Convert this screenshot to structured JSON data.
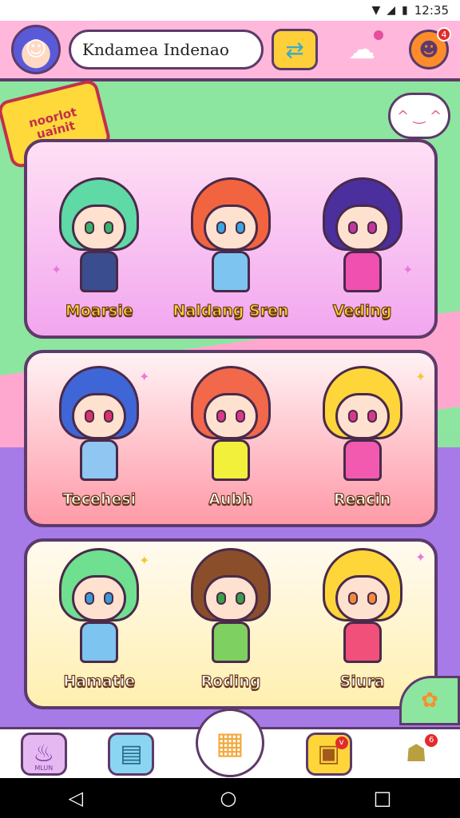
{
  "status_bar": {
    "time": "12:35",
    "icons": [
      "wifi-icon",
      "signal-icon",
      "battery-icon"
    ]
  },
  "header": {
    "title": "Kndamea Indenao",
    "avatar": "avatar",
    "buttons": [
      "swap-icon",
      "ghost-icon",
      "smile-icon"
    ],
    "smile_badge": "4"
  },
  "ribbon": {
    "text": "noorlot uainit"
  },
  "speech_bubble": {
    "text": "^ ‿ ^"
  },
  "rows": [
    {
      "characters": [
        {
          "name": "Moarsie",
          "hair": "#5fd9a6",
          "eye": "#39b56a",
          "body": "#3a4d8f"
        },
        {
          "name": "Naldang Sren",
          "hair": "#f2643f",
          "eye": "#3aa7e0",
          "body": "#7ec4f0"
        },
        {
          "name": "Veding",
          "hair": "#4b2f9c",
          "eye": "#c2389a",
          "body": "#f050b0"
        }
      ]
    },
    {
      "characters": [
        {
          "name": "Tecehesi",
          "hair": "#3f66d6",
          "eye": "#d8336a",
          "body": "#8fc6f2"
        },
        {
          "name": "Aubh",
          "hair": "#f2684a",
          "eye": "#d83a8a",
          "body": "#f2f03a"
        },
        {
          "name": "Reacin",
          "hair": "#ffd63a",
          "eye": "#d83a8a",
          "body": "#f25ab0"
        }
      ]
    },
    {
      "characters": [
        {
          "name": "Hamatie",
          "hair": "#6fe08f",
          "eye": "#3a9ad8",
          "body": "#7ec4f0"
        },
        {
          "name": "Roding",
          "hair": "#8a4f2a",
          "eye": "#39a04a",
          "body": "#7ed060"
        },
        {
          "name": "Siura",
          "hair": "#ffd63a",
          "eye": "#f28a3a",
          "body": "#f0507a"
        }
      ]
    }
  ],
  "bottom_nav": {
    "items": [
      {
        "icon": "potion-icon",
        "label": "MLUN"
      },
      {
        "icon": "card-icon",
        "label": ""
      },
      {
        "icon": "basket-icon",
        "label": ""
      },
      {
        "icon": "bag-icon",
        "label": "",
        "badge": "v"
      },
      {
        "icon": "creature-icon",
        "label": "",
        "badge": "6"
      }
    ]
  },
  "system_nav": [
    "back-icon",
    "home-icon",
    "recents-icon"
  ],
  "colors": {
    "outline": "#5d3a6a",
    "header_bg": "#ffb8dc",
    "green_bg": "#8ce6a0",
    "purple_bg": "#a67be8",
    "accent_yellow": "#ffcf3a"
  }
}
